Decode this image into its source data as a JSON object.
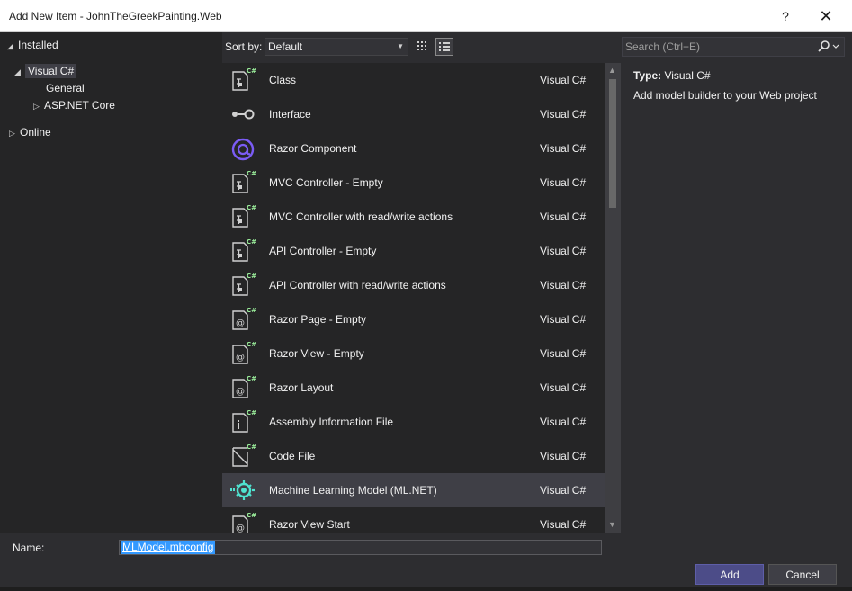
{
  "window": {
    "title": "Add New Item - JohnTheGreekPainting.Web",
    "help": "?",
    "close": "✕"
  },
  "tree": {
    "installed": "Installed",
    "visual_csharp": "Visual C#",
    "general": "General",
    "aspnet_core": "ASP.NET Core",
    "online": "Online"
  },
  "toolbar": {
    "sort_label": "Sort by:",
    "sort_value": "Default"
  },
  "search": {
    "placeholder": "Search (Ctrl+E)"
  },
  "items": [
    {
      "name": "Class",
      "lang": "Visual C#",
      "icon": "csharp-class-icon"
    },
    {
      "name": "Interface",
      "lang": "Visual C#",
      "icon": "interface-icon"
    },
    {
      "name": "Razor Component",
      "lang": "Visual C#",
      "icon": "razor-component-icon"
    },
    {
      "name": "MVC Controller - Empty",
      "lang": "Visual C#",
      "icon": "csharp-class-icon"
    },
    {
      "name": "MVC Controller with read/write actions",
      "lang": "Visual C#",
      "icon": "csharp-class-icon"
    },
    {
      "name": "API Controller - Empty",
      "lang": "Visual C#",
      "icon": "csharp-class-icon"
    },
    {
      "name": "API Controller with read/write actions",
      "lang": "Visual C#",
      "icon": "csharp-class-icon"
    },
    {
      "name": "Razor Page - Empty",
      "lang": "Visual C#",
      "icon": "razor-file-icon"
    },
    {
      "name": "Razor View - Empty",
      "lang": "Visual C#",
      "icon": "razor-file-icon"
    },
    {
      "name": "Razor Layout",
      "lang": "Visual C#",
      "icon": "razor-file-icon"
    },
    {
      "name": "Assembly Information File",
      "lang": "Visual C#",
      "icon": "info-file-icon"
    },
    {
      "name": "Code File",
      "lang": "Visual C#",
      "icon": "code-file-icon"
    },
    {
      "name": "Machine Learning Model (ML.NET)",
      "lang": "Visual C#",
      "icon": "ml-model-icon"
    },
    {
      "name": "Razor View Start",
      "lang": "Visual C#",
      "icon": "razor-file-icon"
    }
  ],
  "info": {
    "type_label": "Type:",
    "type_value": "Visual C#",
    "description": "Add model builder to your Web project"
  },
  "name_field": {
    "label": "Name:",
    "value": "MLModel.mbconfig"
  },
  "buttons": {
    "add": "Add",
    "cancel": "Cancel"
  },
  "colors": {
    "accent": "#3399ff",
    "ml_teal": "#4fe3d0",
    "csharp_green": "#9ff59f",
    "razor_purple": "#7b5cf5"
  }
}
